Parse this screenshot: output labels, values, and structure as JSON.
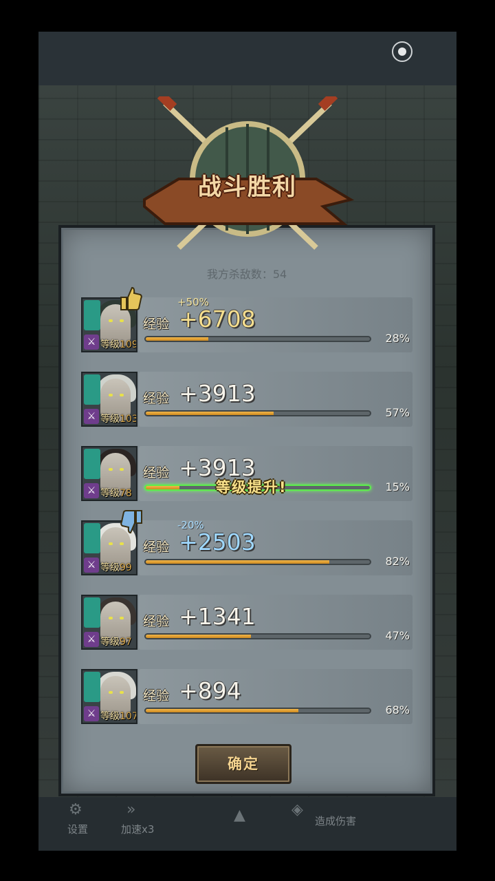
{
  "header": {
    "title": "战斗胜利"
  },
  "summary": {
    "kills_label": "我方杀敌数：",
    "kills_value": "54"
  },
  "exp_label": "经验",
  "level_prefix": "等级",
  "heroes": [
    {
      "level": "109",
      "exp": "+6708",
      "exp_style": "gold",
      "bonus": "+50%",
      "bonus_style": "gold",
      "progress": 0.28,
      "pct": "28%",
      "badge": "thumb-up",
      "level_up": false,
      "hair": "#2f3a34"
    },
    {
      "level": "103",
      "exp": "+3913",
      "exp_style": "normal",
      "bonus": "",
      "progress": 0.57,
      "pct": "57%",
      "badge": "",
      "level_up": false,
      "hair": "#cfd2cc"
    },
    {
      "level": "78",
      "exp": "+3913",
      "exp_style": "normal",
      "bonus": "",
      "progress": 0.15,
      "pct": "15%",
      "badge": "",
      "level_up": true,
      "level_up_text": "等级提升!",
      "hair": "#2b2523"
    },
    {
      "level": "99",
      "exp": "+2503",
      "exp_style": "blue",
      "bonus": "-20%",
      "bonus_style": "blue",
      "progress": 0.82,
      "pct": "82%",
      "badge": "thumb-down",
      "level_up": false,
      "hair": "#e3e3de"
    },
    {
      "level": "97",
      "exp": "+1341",
      "exp_style": "normal",
      "bonus": "",
      "progress": 0.47,
      "pct": "47%",
      "badge": "",
      "level_up": false,
      "hair": "#3a3430"
    },
    {
      "level": "107",
      "exp": "+894",
      "exp_style": "normal",
      "bonus": "",
      "progress": 0.68,
      "pct": "68%",
      "badge": "",
      "level_up": false,
      "hair": "#d8d8d2"
    }
  ],
  "confirm_label": "确定",
  "bottom": {
    "settings": "设置",
    "speed": "加速x3",
    "damage": "造成伤害"
  },
  "colors": {
    "accent_gold": "#f0b64a",
    "levelup_green": "#5bee4a",
    "panel": "#838e94"
  },
  "icons": {
    "weapon": "sword-icon",
    "class": "helmet-icon",
    "record": "record-icon"
  }
}
